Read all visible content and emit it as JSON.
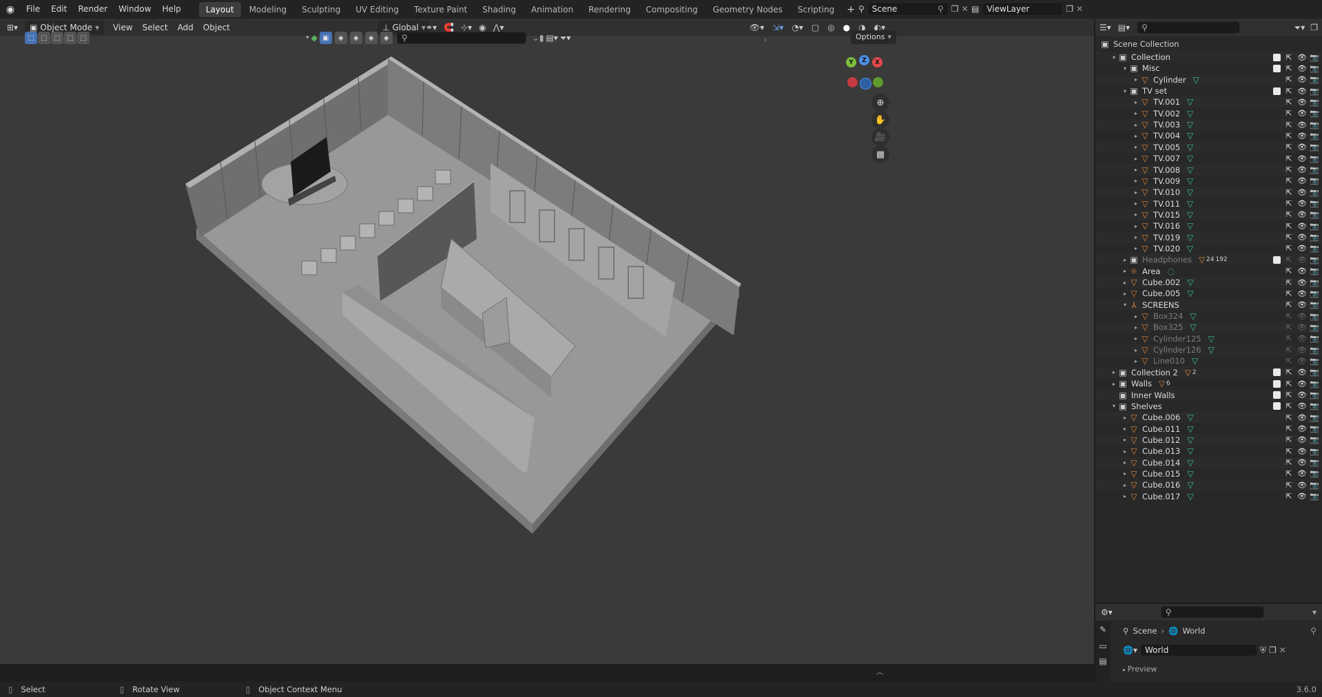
{
  "topbar": {
    "menus": [
      "File",
      "Edit",
      "Render",
      "Window",
      "Help"
    ],
    "workspaces": [
      "Layout",
      "Modeling",
      "Sculpting",
      "UV Editing",
      "Texture Paint",
      "Shading",
      "Animation",
      "Rendering",
      "Compositing",
      "Geometry Nodes",
      "Scripting"
    ],
    "active_workspace": "Layout",
    "add_tab": "+",
    "scene_name": "Scene",
    "view_layer": "ViewLayer"
  },
  "viewport": {
    "mode": "Object Mode",
    "menus": [
      "View",
      "Select",
      "Add",
      "Object"
    ],
    "orientation": "Global",
    "options_label": "Options",
    "gizmo_axes": {
      "x": "X",
      "y": "Y",
      "z": "Z"
    },
    "colors": {
      "x_axis": "#e5484d",
      "y_axis": "#7dbd3c",
      "z_axis": "#4c8fe6",
      "accent": "#4772b3"
    }
  },
  "outliner": {
    "root": "Scene Collection",
    "rows": [
      {
        "label": "Collection",
        "indent": 1,
        "kind": "collection",
        "open": true,
        "check": true
      },
      {
        "label": "Misc",
        "indent": 2,
        "kind": "collection",
        "open": true,
        "check": true
      },
      {
        "label": "Cylinder",
        "indent": 3,
        "kind": "mesh",
        "open": false,
        "data": true
      },
      {
        "label": "TV set",
        "indent": 2,
        "kind": "collection",
        "open": true,
        "check": true
      },
      {
        "label": "TV.001",
        "indent": 3,
        "kind": "mesh",
        "data": true
      },
      {
        "label": "TV.002",
        "indent": 3,
        "kind": "mesh",
        "data": true
      },
      {
        "label": "TV.003",
        "indent": 3,
        "kind": "mesh",
        "data": true
      },
      {
        "label": "TV.004",
        "indent": 3,
        "kind": "mesh",
        "data": true
      },
      {
        "label": "TV.005",
        "indent": 3,
        "kind": "mesh",
        "data": true
      },
      {
        "label": "TV.007",
        "indent": 3,
        "kind": "mesh",
        "data": true
      },
      {
        "label": "TV.008",
        "indent": 3,
        "kind": "mesh",
        "data": true
      },
      {
        "label": "TV.009",
        "indent": 3,
        "kind": "mesh",
        "data": true
      },
      {
        "label": "TV.010",
        "indent": 3,
        "kind": "mesh",
        "data": true
      },
      {
        "label": "TV.011",
        "indent": 3,
        "kind": "mesh",
        "data": true
      },
      {
        "label": "TV.015",
        "indent": 3,
        "kind": "mesh",
        "data": true
      },
      {
        "label": "TV.016",
        "indent": 3,
        "kind": "mesh",
        "data": true
      },
      {
        "label": "TV.019",
        "indent": 3,
        "kind": "mesh",
        "data": true
      },
      {
        "label": "TV.020",
        "indent": 3,
        "kind": "mesh",
        "data": true
      },
      {
        "label": "Headphones",
        "indent": 2,
        "kind": "collection",
        "dim": true,
        "check": true,
        "badges": [
          "24",
          "192"
        ]
      },
      {
        "label": "Area",
        "indent": 2,
        "kind": "light",
        "data": true
      },
      {
        "label": "Cube.002",
        "indent": 2,
        "kind": "mesh",
        "data": true
      },
      {
        "label": "Cube.005",
        "indent": 2,
        "kind": "mesh",
        "data": true
      },
      {
        "label": "SCREENS",
        "indent": 2,
        "kind": "empty",
        "open": true
      },
      {
        "label": "Box324",
        "indent": 3,
        "kind": "mesh",
        "dim": true,
        "data": true
      },
      {
        "label": "Box325",
        "indent": 3,
        "kind": "mesh",
        "dim": true,
        "data": true
      },
      {
        "label": "Cylinder125",
        "indent": 3,
        "kind": "mesh",
        "dim": true,
        "data": true
      },
      {
        "label": "Cylinder126",
        "indent": 3,
        "kind": "mesh",
        "dim": true,
        "data": true
      },
      {
        "label": "Line010",
        "indent": 3,
        "kind": "mesh",
        "dim": true,
        "data": true
      },
      {
        "label": "Collection 2",
        "indent": 1,
        "kind": "collection",
        "check": true,
        "badges": [
          "2"
        ]
      },
      {
        "label": "Walls",
        "indent": 1,
        "kind": "collection",
        "check": true,
        "badges": [
          "6"
        ]
      },
      {
        "label": "Inner Walls",
        "indent": 1,
        "kind": "collection",
        "check": true,
        "no_tri": true
      },
      {
        "label": "Shelves",
        "indent": 1,
        "kind": "collection",
        "open": true,
        "check": true
      },
      {
        "label": "Cube.006",
        "indent": 2,
        "kind": "mesh",
        "data": true
      },
      {
        "label": "Cube.011",
        "indent": 2,
        "kind": "mesh",
        "data": true
      },
      {
        "label": "Cube.012",
        "indent": 2,
        "kind": "mesh",
        "data": true
      },
      {
        "label": "Cube.013",
        "indent": 2,
        "kind": "mesh",
        "data": true
      },
      {
        "label": "Cube.014",
        "indent": 2,
        "kind": "mesh",
        "data": true
      },
      {
        "label": "Cube.015",
        "indent": 2,
        "kind": "mesh",
        "data": true
      },
      {
        "label": "Cube.016",
        "indent": 2,
        "kind": "mesh",
        "data": true
      },
      {
        "label": "Cube.017",
        "indent": 2,
        "kind": "mesh",
        "data": true
      }
    ]
  },
  "properties": {
    "breadcrumb_scene": "Scene",
    "breadcrumb_world": "World",
    "world_name": "World",
    "preview_label": "Preview"
  },
  "statusbar": {
    "items": [
      "Select",
      "Rotate View",
      "Object Context Menu"
    ],
    "version": "3.6.0"
  }
}
